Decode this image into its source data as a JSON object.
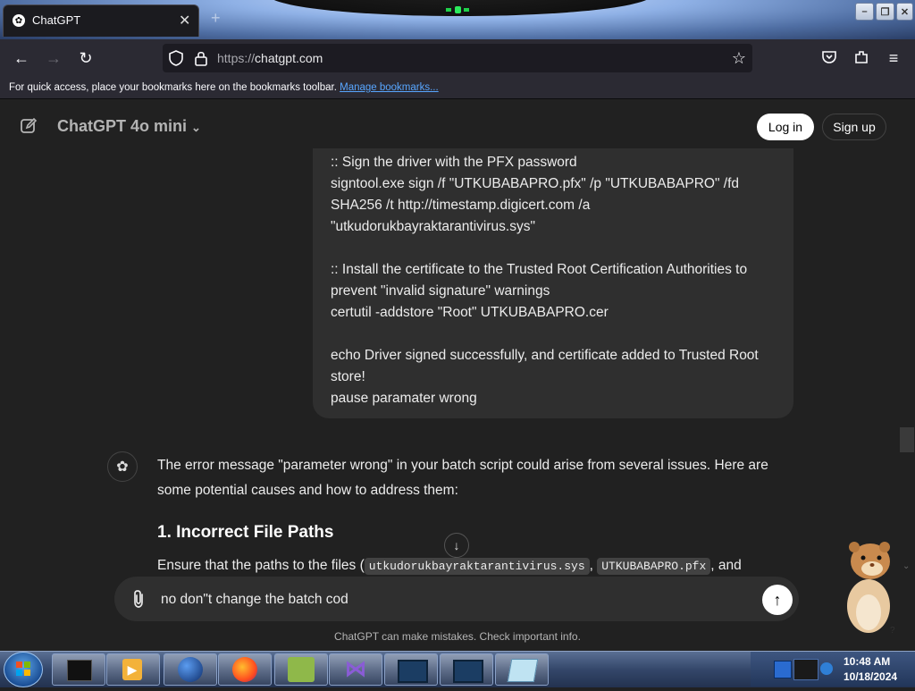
{
  "browser": {
    "tab_title": "ChatGPT",
    "url_prefix": "https://",
    "url_host": "chatgpt.com",
    "bookmarks_text": "For quick access, place your bookmarks here on the bookmarks toolbar.",
    "bookmarks_link": "Manage bookmarks..."
  },
  "header": {
    "model": "ChatGPT 4o mini",
    "login": "Log in",
    "signup": "Sign up"
  },
  "user_message": {
    "lines": [
      ":: Sign the driver with the PFX password",
      "signtool.exe sign /f \"UTKUBABAPRO.pfx\" /p \"UTKUBABAPRO\" /fd",
      "SHA256 /t http://timestamp.digicert.com /a",
      "\"utkudorukbayraktarantivirus.sys\"",
      ":: Install the certificate to the Trusted Root Certification Authorities to",
      "prevent \"invalid signature\" warnings",
      "certutil -addstore \"Root\" UTKUBABAPRO.cer",
      "echo Driver signed successfully, and certificate added to Trusted Root",
      "store!",
      "pause paramater wrong"
    ]
  },
  "assistant": {
    "intro_line1": "The error message \"parameter wrong\" in your batch script could arise from several issues. Here are",
    "intro_line2": "some potential causes and how to address them:",
    "heading": "1. Incorrect File Paths",
    "para_start": "Ensure that the paths to the files (",
    "code1": "utkudorukbayraktarantivirus.sys",
    "code2": "UTKUBABAPRO.pfx",
    "para_end": ", and"
  },
  "composer": {
    "value": "no don\"t change the batch cod"
  },
  "disclaimer": "ChatGPT can make mistakes. Check important info.",
  "taskbar": {
    "time": "10:48 AM",
    "date": "10/18/2024"
  }
}
